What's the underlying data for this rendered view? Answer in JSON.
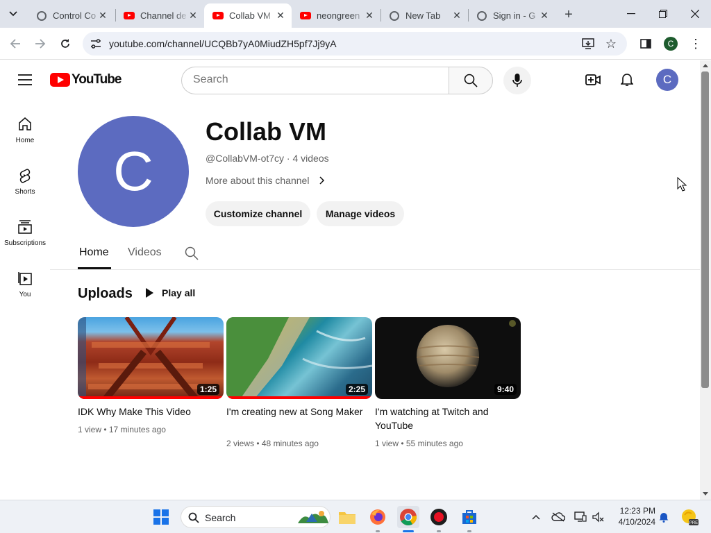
{
  "browser": {
    "tabs": [
      {
        "title": "Control Co",
        "icon": "globe-icon"
      },
      {
        "title": "Channel de",
        "icon": "youtube-icon"
      },
      {
        "title": "Collab VM",
        "icon": "youtube-icon",
        "active": true
      },
      {
        "title": "neongreen",
        "icon": "youtube-icon"
      },
      {
        "title": "New Tab",
        "icon": "globe-icon"
      },
      {
        "title": "Sign in - G",
        "icon": "globe-icon"
      }
    ],
    "url": "youtube.com/channel/UCQBb7yA0MiudZH5pf7Jj9yA",
    "profile_initial": "C"
  },
  "youtube": {
    "logo_text": "YouTube",
    "search_placeholder": "Search",
    "account_initial": "C",
    "guide": [
      {
        "label": "Home",
        "icon": "home-icon"
      },
      {
        "label": "Shorts",
        "icon": "shorts-icon"
      },
      {
        "label": "Subscriptions",
        "icon": "subscriptions-icon"
      },
      {
        "label": "You",
        "icon": "you-icon"
      }
    ]
  },
  "channel": {
    "avatar_initial": "C",
    "name": "Collab VM",
    "meta": "@CollabVM-ot7cy · 4 videos",
    "more": "More about this channel",
    "customize_label": "Customize channel",
    "manage_label": "Manage videos",
    "tabs": [
      "Home",
      "Videos"
    ]
  },
  "uploads": {
    "title": "Uploads",
    "play_all": "Play all",
    "videos": [
      {
        "title": "IDK Why Make This Video",
        "meta": "1 view • 17 minutes ago",
        "duration": "1:25",
        "watched": 1.0
      },
      {
        "title": "I'm creating new at Song Maker",
        "meta": "2 views • 48 minutes ago",
        "duration": "2:25",
        "watched": 1.0
      },
      {
        "title": "I'm watching at Twitch and YouTube",
        "meta": "1 view • 55 minutes ago",
        "duration": "9:40",
        "watched": 0
      }
    ]
  },
  "taskbar": {
    "search_label": "Search",
    "time": "12:23 PM",
    "date": "4/10/2024"
  },
  "colors": {
    "youtube_red": "#ff0000",
    "avatar_blue": "#5c6bc0",
    "tabstrip": "#dfe3eb"
  }
}
